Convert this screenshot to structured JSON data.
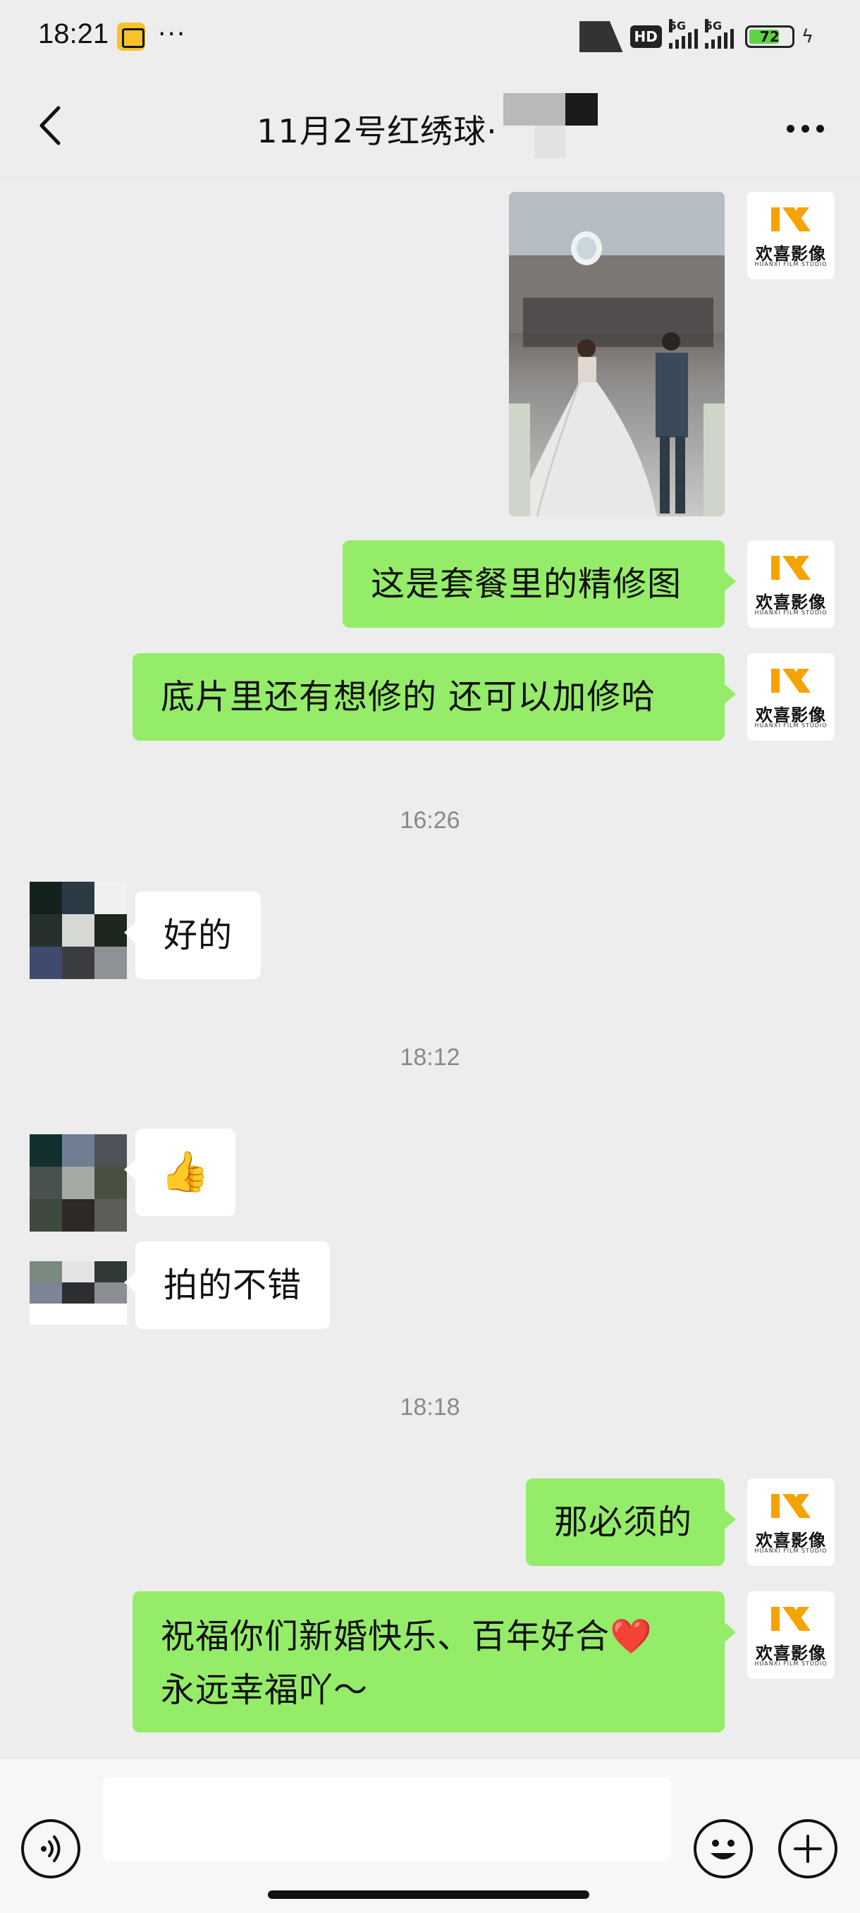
{
  "status_bar": {
    "time": "18:21",
    "app_badge_icon": "app-notification-icon",
    "overflow": "···",
    "hd_label": "HD",
    "network_label_1": "5G",
    "network_label_2": "5G",
    "battery_level": "72",
    "battery_fraction": 0.72,
    "charging_icon": "bolt-icon"
  },
  "header": {
    "back_icon": "chevron-left-icon",
    "title": "11月2号红绣球·",
    "more_icon": "more-dots-icon"
  },
  "brand_avatar": {
    "name": "欢喜影像",
    "subtitle": "HUANXI FILM STUDIO",
    "accent": "#f5a300"
  },
  "messages": [
    {
      "id": "m1",
      "from": "me",
      "type": "image",
      "alt": "wedding-photo"
    },
    {
      "id": "m2",
      "from": "me",
      "type": "text",
      "text": "这是套餐里的精修图"
    },
    {
      "id": "m3",
      "from": "me",
      "type": "text",
      "text": "底片里还有想修的  还可以加修哈"
    },
    {
      "id": "t1",
      "type": "timestamp",
      "text": "16:26"
    },
    {
      "id": "m4",
      "from": "them",
      "type": "text",
      "text": "好的"
    },
    {
      "id": "t2",
      "type": "timestamp",
      "text": "18:12"
    },
    {
      "id": "m5",
      "from": "them",
      "type": "emoji",
      "text": "👍"
    },
    {
      "id": "m6",
      "from": "them",
      "type": "text",
      "text": "拍的不错"
    },
    {
      "id": "t3",
      "type": "timestamp",
      "text": "18:18"
    },
    {
      "id": "m7",
      "from": "me",
      "type": "text",
      "text": "那必须的"
    },
    {
      "id": "m8",
      "from": "me",
      "type": "text",
      "text": "祝福你们新婚快乐、百年好合❤️\n永远幸福吖～"
    }
  ],
  "input_bar": {
    "voice_icon": "voice-icon",
    "placeholder": "",
    "emoji_icon": "emoji-icon",
    "plus_icon": "plus-icon"
  },
  "colors": {
    "my_bubble": "#95ec69",
    "their_bubble": "#ffffff",
    "background": "#ededed"
  }
}
